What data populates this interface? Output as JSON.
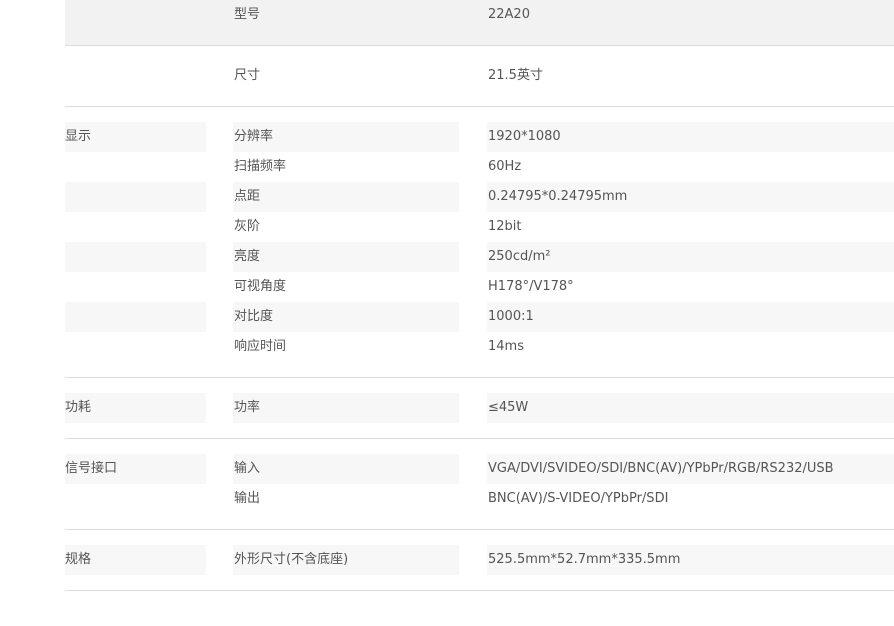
{
  "groups": [
    {
      "category": "",
      "rows": [
        {
          "label": "型号",
          "value": "22A20"
        }
      ]
    },
    {
      "category": "",
      "rows": [
        {
          "label": "尺寸",
          "value": "21.5英寸"
        }
      ]
    },
    {
      "category": "显示",
      "rows": [
        {
          "label": "分辨率",
          "value": "1920*1080"
        },
        {
          "label": "扫描频率",
          "value": "60Hz"
        },
        {
          "label": "点距",
          "value": "0.24795*0.24795mm"
        },
        {
          "label": "灰阶",
          "value": "12bit"
        },
        {
          "label": "亮度",
          "value": "250cd/m²"
        },
        {
          "label": "可视角度",
          "value": "H178°/V178°"
        },
        {
          "label": "对比度",
          "value": "1000:1"
        },
        {
          "label": "响应时间",
          "value": "14ms"
        }
      ]
    },
    {
      "category": "功耗",
      "rows": [
        {
          "label": "功率",
          "value": "≤45W"
        }
      ]
    },
    {
      "category": "信号接口",
      "rows": [
        {
          "label": "输入",
          "value": "VGA/DVI/SVIDEO/SDI/BNC(AV)/YPbPr/RGB/RS232/USB"
        },
        {
          "label": "输出",
          "value": "BNC(AV)/S-VIDEO/YPbPr/SDI"
        }
      ]
    },
    {
      "category": "规格",
      "rows": [
        {
          "label": "外形尺寸(不含底座)",
          "value": "525.5mm*52.7mm*335.5mm"
        }
      ]
    }
  ]
}
